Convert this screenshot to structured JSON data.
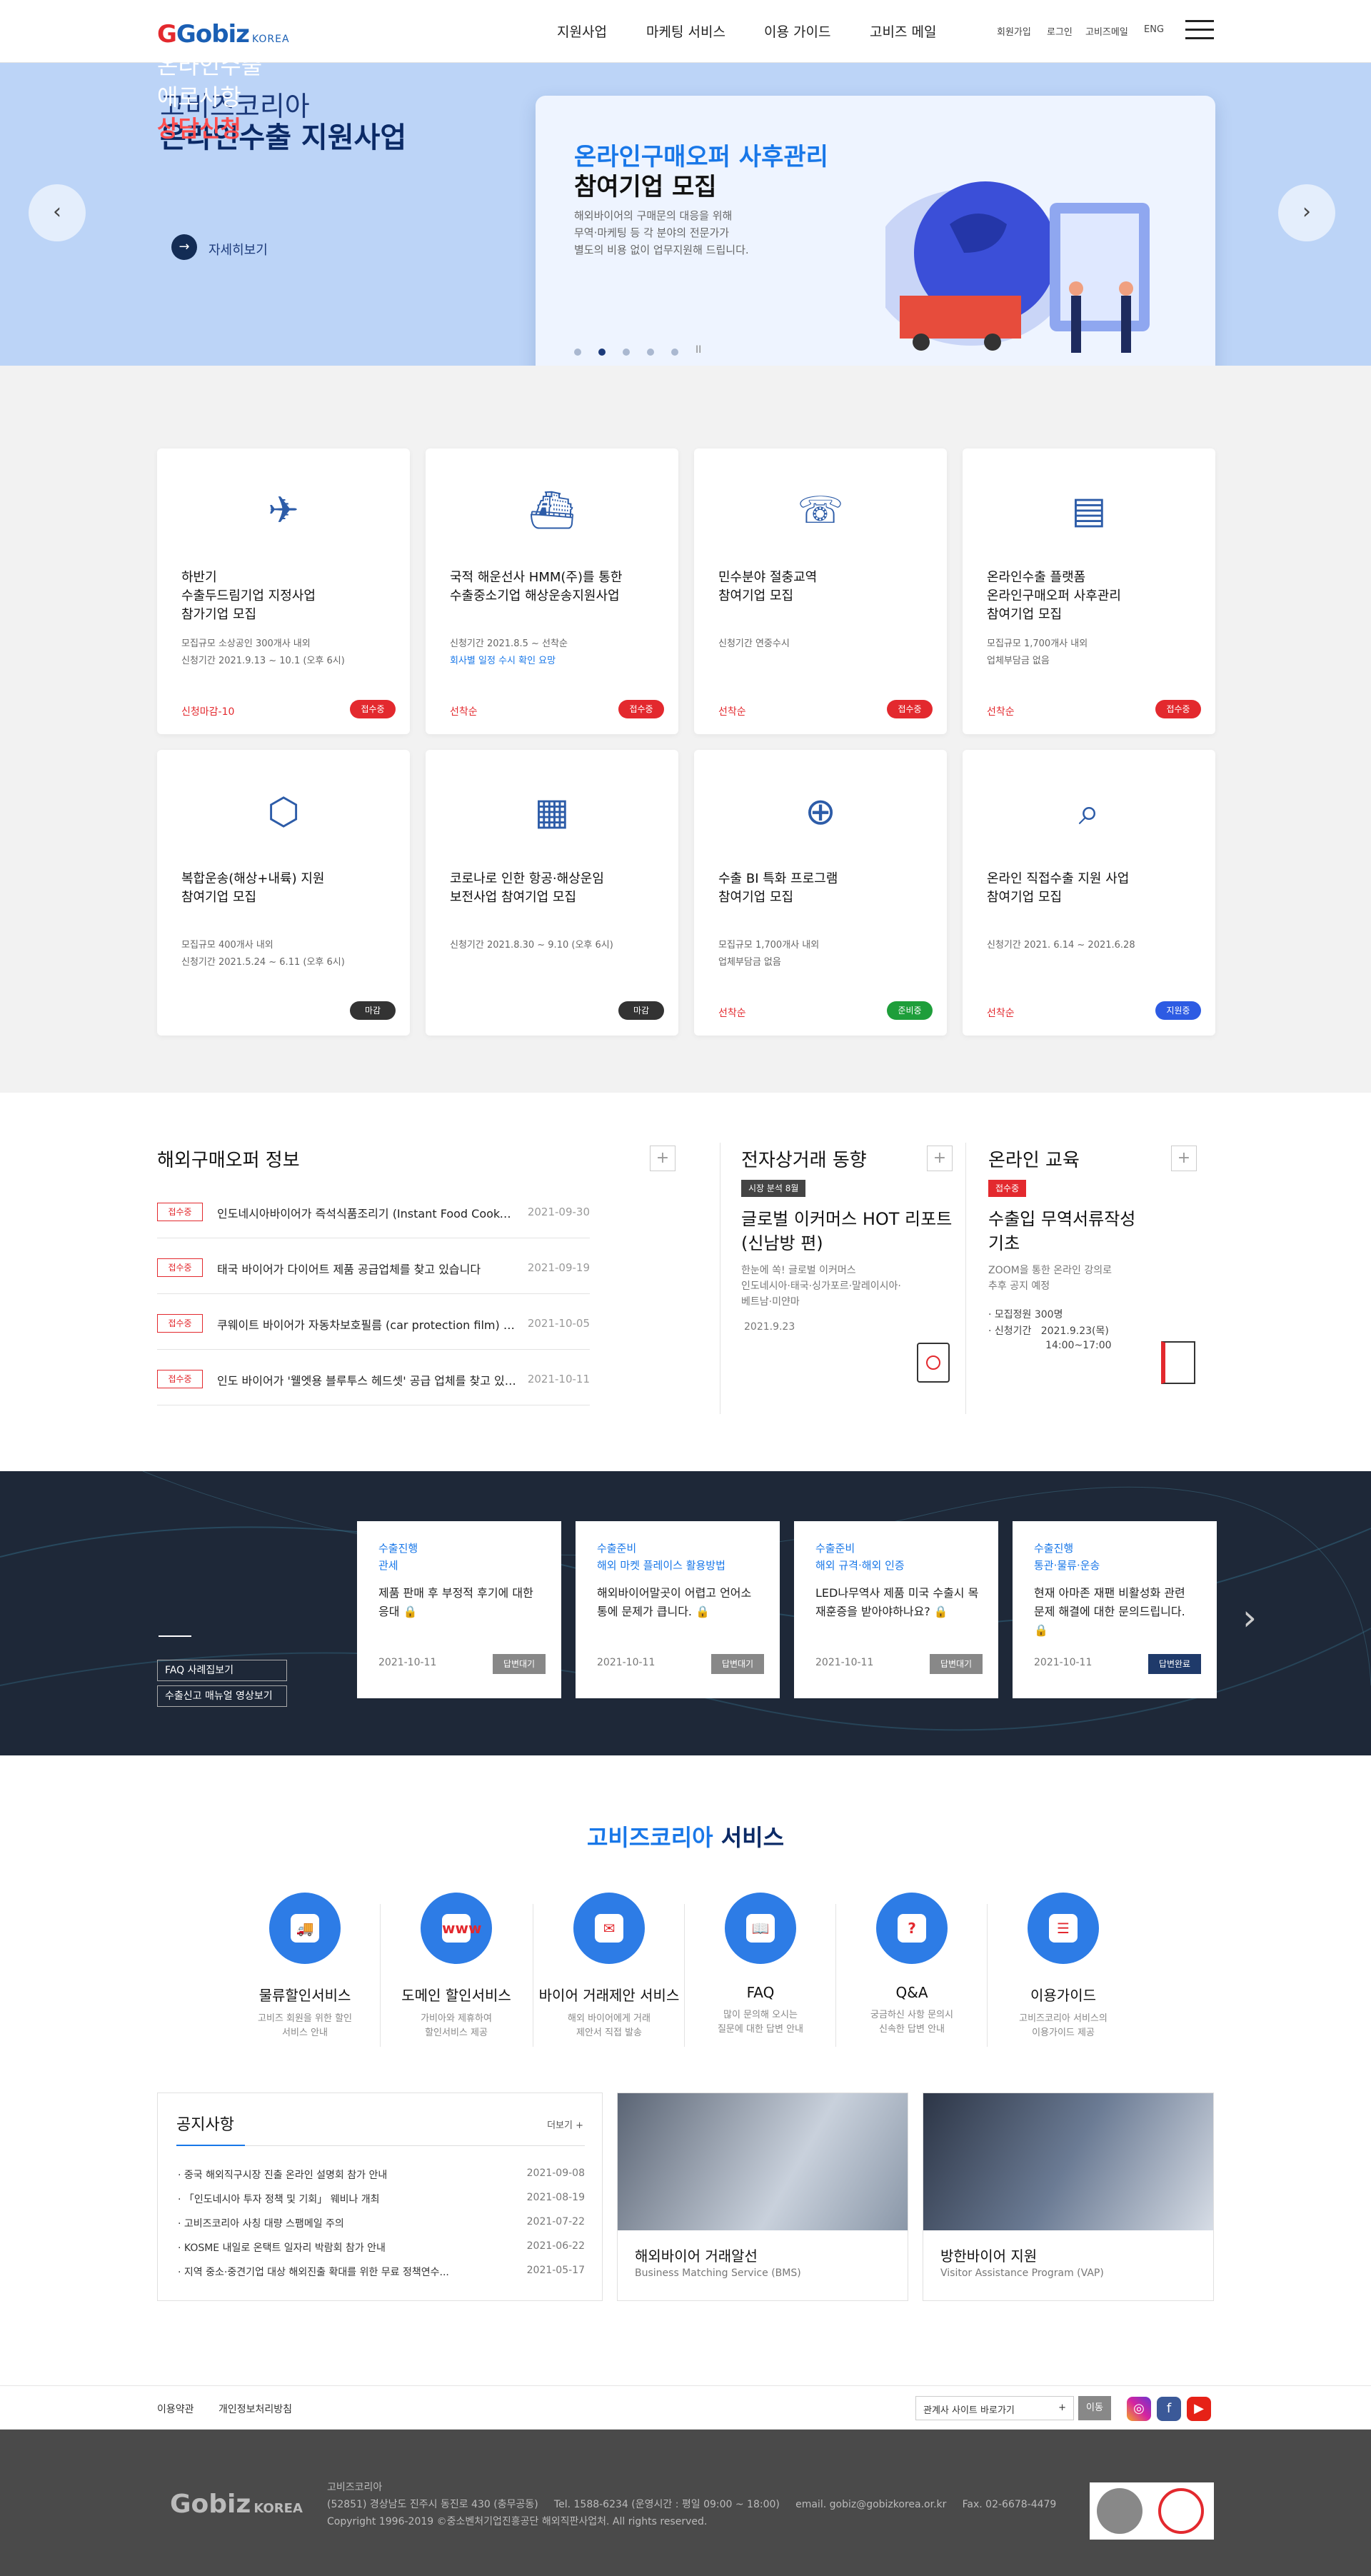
{
  "header": {
    "logo_main": "Gobiz",
    "logo_sub": "KOREA",
    "nav": [
      "지원사업",
      "마케팅 서비스",
      "이용 가이드",
      "고비즈 메일"
    ],
    "util": [
      "회원가입",
      "로그인",
      "고비즈메일",
      "ENG"
    ]
  },
  "hero": {
    "title1": "고비즈코리아",
    "title2": "온라인수출 지원사업",
    "more_label": "자세히보기",
    "card_title1": "온라인구매오퍼 사후관리",
    "card_title2": "참여기업 모집",
    "card_desc": "해외바이어의 구매문의 대응을 위해\n무역·마케팅 등 각 분야의 전문가가\n별도의 비용 없이 업무지원해 드립니다.",
    "pause_label": "II"
  },
  "biz_cards": [
    {
      "title": "하반기\n수출두드림기업 지정사업\n참가기업 모집",
      "m1": "모집규모    소상공인 300개사 내외",
      "m2": "신청기간    2021.9.13 ~ 10.1 (오후 6시)",
      "deadline": "신청마감-10",
      "badge": "접수중",
      "badge_color": "#e3292e",
      "icon": "airplane-icon"
    },
    {
      "title": "국적 해운선사 HMM(주)를 통한\n수출중소기업 해상운송지원사업",
      "m1": "신청기간    2021.8.5 ~ 선착순",
      "m2": "회사별 일정 수시 확인 요망",
      "deadline": "선착순",
      "badge": "접수중",
      "badge_color": "#e3292e",
      "icon": "ship-icon"
    },
    {
      "title": "민수분야 절충교역\n참여기업 모집",
      "m1": "신청기간    연중수시",
      "m2": "",
      "deadline": "선착순",
      "badge": "접수중",
      "badge_color": "#e3292e",
      "icon": "meeting-icon"
    },
    {
      "title": "온라인수출 플랫폼\n온라인구매오퍼 사후관리\n참여기업 모집",
      "m1": "모집규모    1,700개사 내외",
      "m2": "업체부담금  없음",
      "deadline": "선착순",
      "badge": "접수중",
      "badge_color": "#e3292e",
      "icon": "report-icon"
    },
    {
      "title": "복합운송(해상+내륙) 지원\n참여기업 모집",
      "m1": "모집규모    400개사 내외",
      "m2": "신청기간    2021.5.24 ~ 6.11 (오후 6시)",
      "deadline": "",
      "badge": "마감",
      "badge_color": "#333333",
      "icon": "box-icon"
    },
    {
      "title": "코로나로 인한 항공·해상운임\n보전사업 참여기업 모집",
      "m1": "신청기간    2021.8.30 ~ 9.10 (오후 6시)",
      "m2": "",
      "deadline": "",
      "badge": "마감",
      "badge_color": "#333333",
      "icon": "money-icon"
    },
    {
      "title": "수출 BI 특화 프로그램\n참여기업 모집",
      "m1": "모집규모    1,700개사 내외",
      "m2": "업체부담금  없음",
      "deadline": "선착순",
      "badge": "준비중",
      "badge_color": "#1e9e3a",
      "icon": "globe-user-icon"
    },
    {
      "title": "온라인 직접수출 지원 사업\n참여기업 모집",
      "m1": "신청기간    2021. 6.14 ~ 2021.6.28",
      "m2": "",
      "deadline": "선착순",
      "badge": "지원중",
      "badge_color": "#2d5be3",
      "icon": "laptop-search-icon"
    }
  ],
  "buyer": {
    "title": "해외구매오퍼 정보",
    "rows": [
      {
        "tag": "접수중",
        "text": "인도네시아바이어가 즉석식품조리기 (Instant Food Cooker) 제조업체...",
        "date": "2021-09-30"
      },
      {
        "tag": "접수중",
        "text": "태국 바이어가 다이어트 제품 공급업체를 찾고 있습니다",
        "date": "2021-09-19"
      },
      {
        "tag": "접수중",
        "text": "쿠웨이트 바이어가 자동차보호필름 (car protection film) 제조업체를 ...",
        "date": "2021-10-05"
      },
      {
        "tag": "접수중",
        "text": "인도 바이어가 '웰엣용 블루투스 헤드셋' 공급 업체를 찾고 있습니다",
        "date": "2021-10-11"
      }
    ]
  },
  "ecommerce": {
    "title": "전자상거래 동향",
    "tag": "시장 분석 8월",
    "headline": "글로벌 이커머스 HOT 리포트\n(신남방 편)",
    "desc": "한눈에 쏙! 글로벌 이커머스\n인도네시아·태국·싱가포르·말레이시아·\n베트남·미얀마",
    "date": "2021.9.23"
  },
  "edu": {
    "title": "온라인 교육",
    "tag": "접수중",
    "headline": "수출입 무역서류작성\n기초",
    "desc": "ZOOM을 통한 온라인 강의로\n추후 공지 예정",
    "m1": "· 모집정원   300명",
    "m2": "· 신청기간   2021.9.23(목)\n                  14:00~17:00"
  },
  "consult": {
    "title1": "온라인수출",
    "title2": "애로사항",
    "title3": "상담신청",
    "btn1": "FAQ 사례집보기",
    "btn2": "수출신고 매뉴얼 영상보기",
    "cards": [
      {
        "cat": "수출진행\n관세",
        "text": "제품 판매 후 부정적 후기에 대한 응대 🔒",
        "date": "2021-10-11",
        "btn": "답변대기",
        "btn_color": "#888888"
      },
      {
        "cat": "수출준비\n해외 마켓 플레이스 활용방법",
        "text": "해외바이어말곳이 어렵고 언어소통에 문제가 큽니다. 🔒",
        "date": "2021-10-11",
        "btn": "답변대기",
        "btn_color": "#888888"
      },
      {
        "cat": "수출준비\n해외 규격·해외 인증",
        "text": "LED나무역사 제품 미국 수출시 목재훈증을 받아야하나요? 🔒",
        "date": "2021-10-11",
        "btn": "답변대기",
        "btn_color": "#888888"
      },
      {
        "cat": "수출진행\n통관·물류·운송",
        "text": "현재 아마존 재팬 비활성화 관련 문제 해결에 대한 문의드립니다. 🔒",
        "date": "2021-10-11",
        "btn": "답변완료",
        "btn_color": "#1f3a6a"
      }
    ]
  },
  "services": {
    "title_a": "고비즈코리아",
    "title_b": " 서비스",
    "items": [
      {
        "name": "물류할인서비스",
        "desc": "고비즈 회원을 위한 할인\n서비스 안내",
        "glyph": "🚚"
      },
      {
        "name": "도메인 할인서비스",
        "desc": "가비아와 제휴하여\n할인서비스 제공",
        "glyph": "www"
      },
      {
        "name": "바이어 거래제안 서비스",
        "desc": "해외 바이어에게 거래\n제안서 직접 발송",
        "glyph": "✉"
      },
      {
        "name": "FAQ",
        "desc": "많이 문의해 오시는\n질문에 대한 답변 안내",
        "glyph": "📖"
      },
      {
        "name": "Q&A",
        "desc": "궁금하신 사항 문의시\n신속한 답변 안내",
        "glyph": "?"
      },
      {
        "name": "이용가이드",
        "desc": "고비즈코리아 서비스의\n이용가이드 제공",
        "glyph": "☰"
      }
    ]
  },
  "notice": {
    "title": "공지사항",
    "more": "더보기 +",
    "items": [
      {
        "text": "중국 해외직구시장 진출 온라인 설명회 참가 안내",
        "date": "2021-09-08"
      },
      {
        "text": "「인도네시아 투자 정책 및 기회」 웨비나 개최",
        "date": "2021-08-19"
      },
      {
        "text": "고비즈코리아 사칭 대량 스팸메일 주의",
        "date": "2021-07-22"
      },
      {
        "text": "KOSME 내일로 온택트 일자리 박람회 참가 안내",
        "date": "2021-06-22"
      },
      {
        "text": "지역 중소·중견기업 대상 해외진출 확대를 위한 무료 정책연수...",
        "date": "2021-05-17"
      }
    ]
  },
  "promo": [
    {
      "title": "해외바이어 거래알선",
      "sub": "Business Matching Service (BMS)"
    },
    {
      "title": "방한바이어 지원",
      "sub": "Visitor Assistance  Program (VAP)"
    }
  ],
  "footer": {
    "links": [
      "이용약관",
      "개인정보처리방침"
    ],
    "site_select": "관계사 사이트 바로가기",
    "go": "이동",
    "org": "고비즈코리아",
    "addr": "(52851) 경상남도 진주시 동진로 430 (충무공동)     Tel. 1588-6234 (운영시간 : 평일 09:00 ~ 18:00)     email. gobiz@gobizkorea.or.kr     Fax. 02-6678-4479",
    "copy": "Copyright 1996-2019 ©중소벤처기업진흥공단 해외직판사업처. All rights reserved."
  }
}
